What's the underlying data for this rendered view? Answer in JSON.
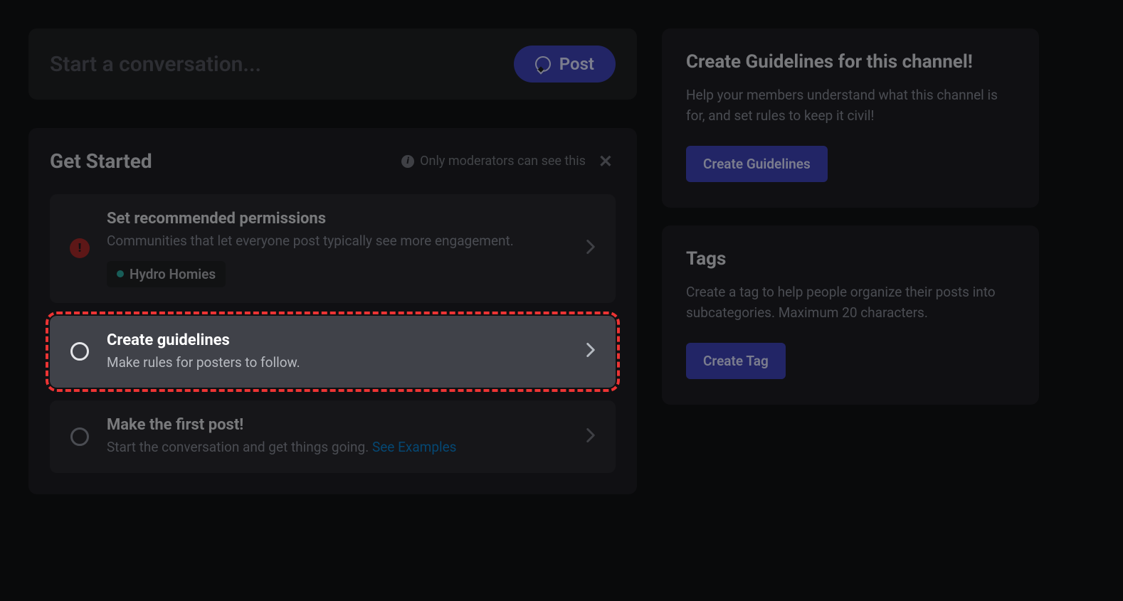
{
  "conversation": {
    "placeholder": "Start a conversation...",
    "post_label": "Post"
  },
  "get_started": {
    "title": "Get Started",
    "moderator_note": "Only moderators can see this",
    "items": [
      {
        "title": "Set recommended permissions",
        "description": "Communities that let everyone post typically see more engagement.",
        "tag": "Hydro Homies"
      },
      {
        "title": "Create guidelines",
        "description": "Make rules for posters to follow."
      },
      {
        "title": "Make the first post!",
        "description": "Start the conversation and get things going.",
        "link_text": "See Examples"
      }
    ]
  },
  "sidebar": {
    "guidelines": {
      "title": "Create Guidelines for this channel!",
      "description": "Help your members understand what this channel is for, and set rules to keep it civil!",
      "button": "Create Guidelines"
    },
    "tags": {
      "title": "Tags",
      "description": "Create a tag to help people organize their posts into subcategories. Maximum 20 characters.",
      "button": "Create Tag"
    }
  }
}
